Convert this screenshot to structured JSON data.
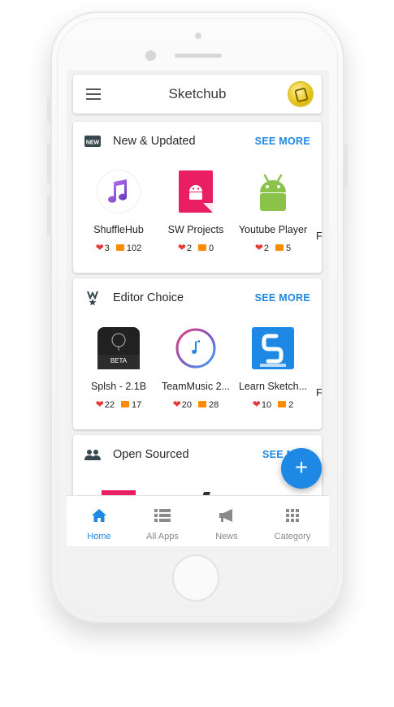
{
  "app": {
    "title": "Sketchub"
  },
  "sections": [
    {
      "title": "New & Updated",
      "see_more": "SEE MORE",
      "icon": "new-badge-icon",
      "apps": [
        {
          "name": "ShuffleHub",
          "likes": "3",
          "comments": "102",
          "icon": "music-notes-icon"
        },
        {
          "name": "SW Projects",
          "likes": "2",
          "comments": "0",
          "icon": "android-file-icon"
        },
        {
          "name": "Youtube Player",
          "likes": "2",
          "comments": "5",
          "icon": "android-robot-icon"
        }
      ],
      "partial": "F"
    },
    {
      "title": "Editor Choice",
      "see_more": "SEE MORE",
      "icon": "award-icon",
      "apps": [
        {
          "name": "Splsh - 2.1B",
          "likes": "22",
          "comments": "17",
          "icon": "beta-app-icon",
          "icon_text": "BETA"
        },
        {
          "name": "TeamMusic 2...",
          "likes": "20",
          "comments": "28",
          "icon": "music-ring-icon"
        },
        {
          "name": "Learn Sketch...",
          "likes": "10",
          "comments": "2",
          "icon": "sketchware-icon"
        }
      ],
      "partial": "F"
    },
    {
      "title": "Open Sourced",
      "see_more": "SEE M",
      "icon": "group-icon"
    }
  ],
  "fab": {
    "label": "+"
  },
  "bottom_nav": [
    {
      "label": "Home",
      "icon": "home-icon",
      "active": true
    },
    {
      "label": "All Apps",
      "icon": "list-icon",
      "active": false
    },
    {
      "label": "News",
      "icon": "megaphone-icon",
      "active": false
    },
    {
      "label": "Category",
      "icon": "grid-icon",
      "active": false
    }
  ],
  "colors": {
    "accent": "#1e88e5",
    "heart": "#e53935",
    "comment": "#fb8c00"
  }
}
